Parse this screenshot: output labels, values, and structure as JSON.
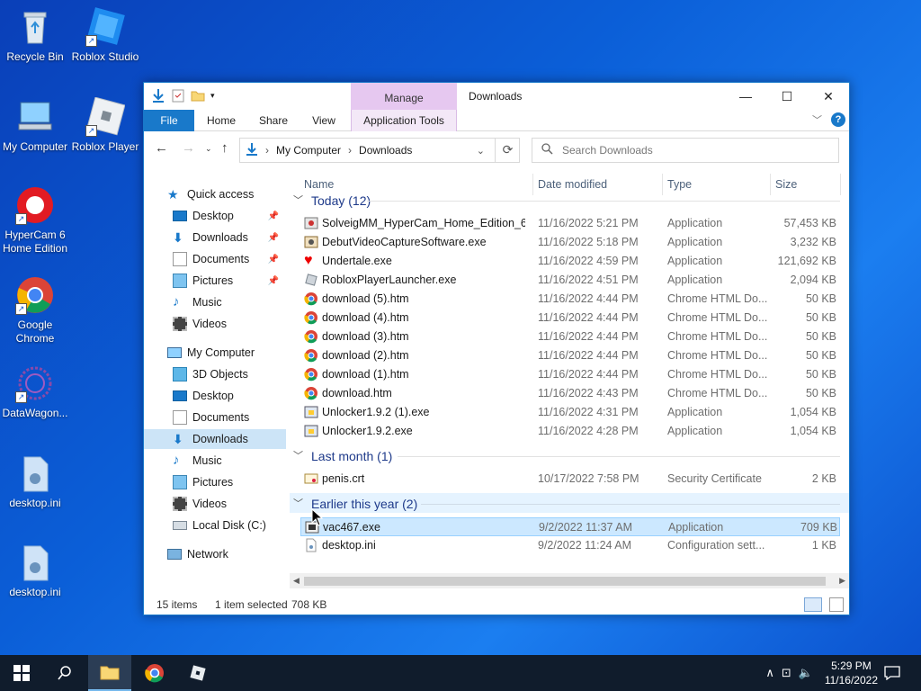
{
  "desktop": {
    "icons": [
      {
        "label": "Recycle Bin"
      },
      {
        "label": "Roblox Studio"
      },
      {
        "label": "My Computer"
      },
      {
        "label": "Roblox Player"
      },
      {
        "label": "HyperCam 6 Home Edition"
      },
      {
        "label": "Google Chrome"
      },
      {
        "label": "DataWagon..."
      },
      {
        "label": "desktop.ini"
      },
      {
        "label": "desktop.ini"
      }
    ]
  },
  "window": {
    "manage_tab": "Manage",
    "title": "Downloads",
    "ribbon": {
      "file": "File",
      "home": "Home",
      "share": "Share",
      "view": "View",
      "app_tools": "Application Tools"
    },
    "address": {
      "crumb1": "My Computer",
      "crumb2": "Downloads"
    },
    "search_placeholder": "Search Downloads",
    "nav": {
      "quick_access": "Quick access",
      "qa_items": [
        "Desktop",
        "Downloads",
        "Documents",
        "Pictures",
        "Music",
        "Videos"
      ],
      "my_computer": "My Computer",
      "mc_items": [
        "3D Objects",
        "Desktop",
        "Documents",
        "Downloads",
        "Music",
        "Pictures",
        "Videos",
        "Local Disk (C:)"
      ],
      "network": "Network"
    },
    "columns": {
      "name": "Name",
      "date": "Date modified",
      "type": "Type",
      "size": "Size"
    },
    "groups": {
      "today": "Today (12)",
      "last_month": "Last month (1)",
      "earlier": "Earlier this year (2)"
    },
    "files": [
      {
        "name": "SolveigMM_HyperCam_Home_Edition_6...",
        "date": "11/16/2022 5:21 PM",
        "type": "Application",
        "size": "57,453 KB"
      },
      {
        "name": "DebutVideoCaptureSoftware.exe",
        "date": "11/16/2022 5:18 PM",
        "type": "Application",
        "size": "3,232 KB"
      },
      {
        "name": "Undertale.exe",
        "date": "11/16/2022 4:59 PM",
        "type": "Application",
        "size": "121,692 KB"
      },
      {
        "name": "RobloxPlayerLauncher.exe",
        "date": "11/16/2022 4:51 PM",
        "type": "Application",
        "size": "2,094 KB"
      },
      {
        "name": "download (5).htm",
        "date": "11/16/2022 4:44 PM",
        "type": "Chrome HTML Do...",
        "size": "50 KB"
      },
      {
        "name": "download (4).htm",
        "date": "11/16/2022 4:44 PM",
        "type": "Chrome HTML Do...",
        "size": "50 KB"
      },
      {
        "name": "download (3).htm",
        "date": "11/16/2022 4:44 PM",
        "type": "Chrome HTML Do...",
        "size": "50 KB"
      },
      {
        "name": "download (2).htm",
        "date": "11/16/2022 4:44 PM",
        "type": "Chrome HTML Do...",
        "size": "50 KB"
      },
      {
        "name": "download (1).htm",
        "date": "11/16/2022 4:44 PM",
        "type": "Chrome HTML Do...",
        "size": "50 KB"
      },
      {
        "name": "download.htm",
        "date": "11/16/2022 4:43 PM",
        "type": "Chrome HTML Do...",
        "size": "50 KB"
      },
      {
        "name": "Unlocker1.9.2 (1).exe",
        "date": "11/16/2022 4:31 PM",
        "type": "Application",
        "size": "1,054 KB"
      },
      {
        "name": "Unlocker1.9.2.exe",
        "date": "11/16/2022 4:28 PM",
        "type": "Application",
        "size": "1,054 KB"
      },
      {
        "name": "penis.crt",
        "date": "10/17/2022 7:58 PM",
        "type": "Security Certificate",
        "size": "2 KB"
      },
      {
        "name": "vac467.exe",
        "date": "9/2/2022 11:37 AM",
        "type": "Application",
        "size": "709 KB"
      },
      {
        "name": "desktop.ini",
        "date": "9/2/2022 11:24 AM",
        "type": "Configuration sett...",
        "size": "1 KB"
      }
    ],
    "status": {
      "items": "15 items",
      "selected": "1 item selected",
      "size": "708 KB"
    }
  },
  "taskbar": {
    "time": "5:29 PM",
    "date": "11/16/2022"
  },
  "colors": {
    "accent": "#1979ca",
    "selection": "#cce8ff",
    "manage": "#e6c8f0"
  }
}
